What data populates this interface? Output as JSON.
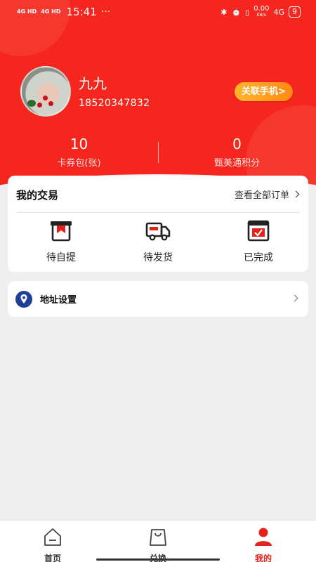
{
  "status_bar": {
    "network1": "4G HD",
    "network2": "4G HD",
    "time": "15:41",
    "more": "···",
    "speed": "0.00",
    "speed_unit": "KB/s",
    "network3": "4G",
    "battery": "9"
  },
  "profile": {
    "name": "九九",
    "phone": "18520347832",
    "link_button": "关联手机>"
  },
  "stats": {
    "left": {
      "value": "10",
      "label": "卡券包(张)"
    },
    "right": {
      "value": "0",
      "label": "甄美通积分"
    }
  },
  "trades": {
    "title": "我的交易",
    "view_all": "查看全部订单",
    "items": [
      {
        "label": "待自提",
        "icon": "pickup-icon"
      },
      {
        "label": "待发货",
        "icon": "truck-icon"
      },
      {
        "label": "已完成",
        "icon": "completed-icon"
      }
    ]
  },
  "address": {
    "label": "地址设置",
    "icon": "location-pin-icon"
  },
  "tabs": [
    {
      "label": "首页",
      "icon": "home-icon",
      "active": false
    },
    {
      "label": "兑换",
      "icon": "bag-icon",
      "active": false
    },
    {
      "label": "我的",
      "icon": "user-icon",
      "active": true
    }
  ],
  "colors": {
    "brand_red": "#f5261d",
    "link_button": "#ff9a1c",
    "active_tab": "#e5211a",
    "address_icon": "#1f3f98"
  }
}
